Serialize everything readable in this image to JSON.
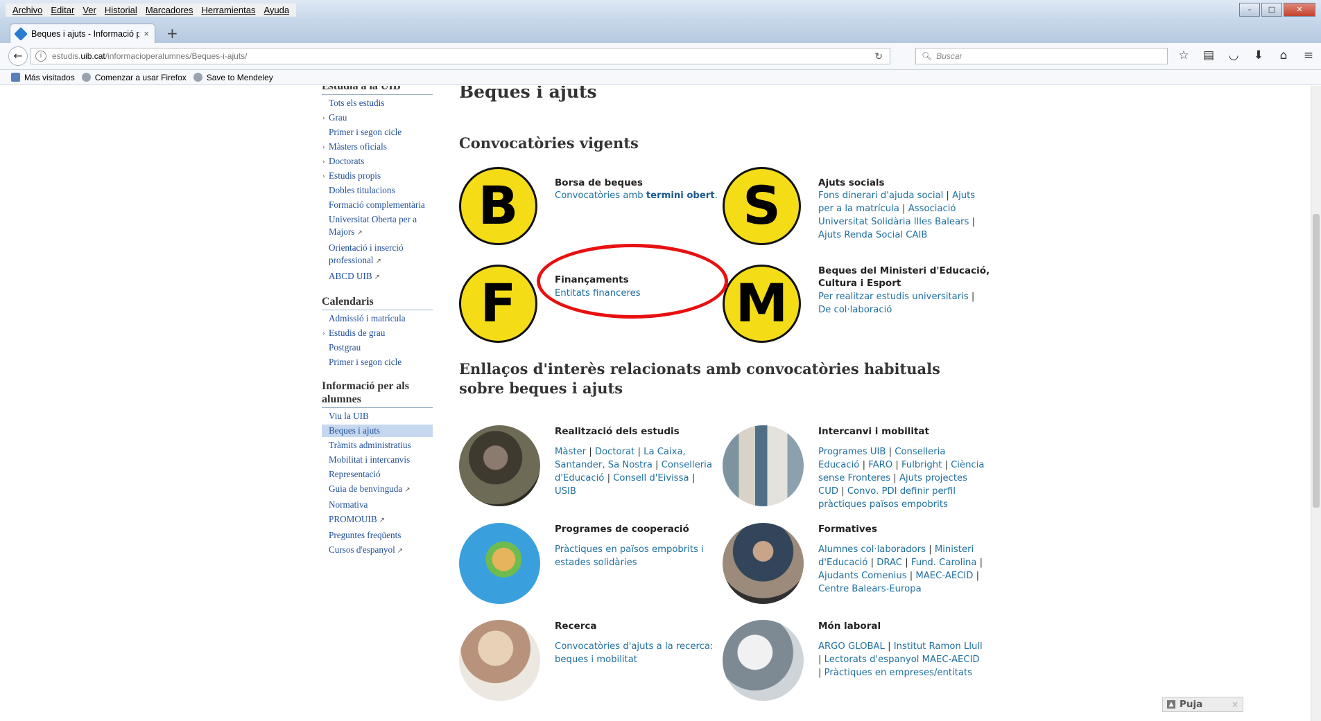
{
  "menubar": [
    "Archivo",
    "Editar",
    "Ver",
    "Historial",
    "Marcadores",
    "Herramientas",
    "Ayuda"
  ],
  "tab": {
    "title": "Beques i ajuts - Informació p",
    "close": "×",
    "new_tab": "+"
  },
  "url": {
    "prefix": "estudis.",
    "domain": "uib.cat",
    "path": "/informacioperalumnes/Beques-i-ajuts/"
  },
  "search": {
    "placeholder": "Buscar"
  },
  "bookmarks": [
    "Más visitados",
    "Comenzar a usar Firefox",
    "Save to Mendeley"
  ],
  "sidebar": {
    "groups": [
      {
        "title": "Estudia a la UIB",
        "items": [
          {
            "label": "Tots els estudis"
          },
          {
            "label": "Grau",
            "arrow": true
          },
          {
            "label": "Primer i segon cicle"
          },
          {
            "label": "Màsters oficials",
            "arrow": true
          },
          {
            "label": "Doctorats",
            "arrow": true
          },
          {
            "label": "Estudis propis",
            "arrow": true
          },
          {
            "label": "Dobles titulacions"
          },
          {
            "label": "Formació complementària"
          },
          {
            "label": "Universitat Oberta per a Majors",
            "ext": "↗"
          },
          {
            "label": "Orientació i inserció professional",
            "ext": "↗"
          },
          {
            "label": "ABCD UIB",
            "ext": "↗"
          }
        ]
      },
      {
        "title": "Calendaris",
        "items": [
          {
            "label": "Admissió i matrícula"
          },
          {
            "label": "Estudis de grau",
            "arrow": true
          },
          {
            "label": "Postgrau"
          },
          {
            "label": "Primer i segon cicle"
          }
        ]
      },
      {
        "title": "Informació per als alumnes",
        "items": [
          {
            "label": "Viu la UIB"
          },
          {
            "label": "Beques i ajuts",
            "selected": true
          },
          {
            "label": "Tràmits administratius"
          },
          {
            "label": "Mobilitat i intercanvis"
          },
          {
            "label": "Representació"
          },
          {
            "label": "Guia de benvinguda",
            "ext": "↗"
          },
          {
            "label": "Normativa"
          },
          {
            "label": "PROMOUIB",
            "ext": "↗"
          },
          {
            "label": "Preguntes freqüents"
          },
          {
            "label": "Cursos d'espanyol",
            "ext": "↗"
          }
        ]
      }
    ]
  },
  "main": {
    "title": "Beques i ajuts",
    "section1": "Convocatòries vigents",
    "badges": [
      {
        "letter": "B",
        "title": "Borsa de beques",
        "text_pre": "Convocatòries amb ",
        "text_bold": "termini obert",
        "text_post": "."
      },
      {
        "letter": "S",
        "title": "Ajuts socials",
        "links": [
          "Fons dinerari d'ajuda social",
          "Ajuts per a la matrícula",
          "Associació Universitat Solidària Illes Balears",
          "Ajuts Renda Social CAIB"
        ]
      },
      {
        "letter": "F",
        "title": "Finançaments",
        "links": [
          "Entitats financeres"
        ]
      },
      {
        "letter": "M",
        "title": "Beques del Ministeri d'Educació, Cultura i Esport",
        "links": [
          "Per realitzar estudis universitaris",
          "De col·laboració"
        ]
      }
    ],
    "section2": "Enllaços d'interès relacionats amb convocatòries habituals sobre beques i ajuts",
    "categories": [
      {
        "title": "Realització dels estudis",
        "links": [
          "Màster",
          "Doctorat",
          "La Caixa, Santander, Sa Nostra",
          "Conselleria d'Educació",
          "Consell d'Eivissa",
          "USIB"
        ]
      },
      {
        "title": "Intercanvi i mobilitat",
        "links": [
          "Programes UIB",
          "Conselleria Educació",
          "FARO",
          "Fulbright",
          "Ciència sense Fronteres",
          "Ajuts projectes CUD",
          "Convo. PDI definir perfil pràctiques països empobrits"
        ]
      },
      {
        "title": "Programes de cooperació",
        "links": [
          "Pràctiques en països empobrits i estades solidàries"
        ]
      },
      {
        "title": "Formatives",
        "links": [
          "Alumnes col·laboradors",
          "Ministeri d'Educació ",
          "DRAC",
          "Fund. Carolina",
          "Ajudants Comenius ",
          "MAEC-AECID",
          "Centre Balears-Europa"
        ]
      },
      {
        "title": "Recerca",
        "links": [
          "Convocatòries d'ajuts a la recerca: beques i mobilitat"
        ]
      },
      {
        "title": "Món laboral",
        "links": [
          "ARGO GLOBAL",
          "Institut Ramon Llull",
          "Lectorats d'espanyol MAEC-AECID",
          "Pràctiques en empreses/entitats"
        ]
      }
    ]
  },
  "puja": {
    "label": "Puja",
    "close": "×"
  },
  "colors": {
    "badge_fill": "#f4dc17",
    "link": "#1f6f9f",
    "annotation": "#e81010"
  }
}
